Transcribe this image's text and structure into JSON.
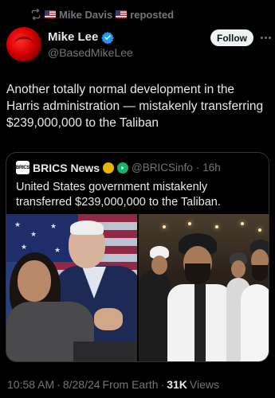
{
  "repost": {
    "icon": "repost-icon",
    "user": "Mike Davis",
    "action": "reposted",
    "flag_icon": "us-flag-icon"
  },
  "author": {
    "display_name": "Mike Lee",
    "handle": "@BasedMikeLee",
    "verified_icon": "verified-badge-icon",
    "avatar_color": "#d60000"
  },
  "actions": {
    "follow_label": "Follow",
    "more_icon": "more-icon"
  },
  "tweet": {
    "text": "Another totally normal development in the Harris administration — mistakenly transferring $239,000,000 to the Taliban"
  },
  "quote": {
    "avatar_text": "BRICS",
    "name": "BRICS News",
    "handle": "@BRICSinfo",
    "separator": "·",
    "time": "16h",
    "text": "United States government mistakenly transferred $239,000,000 to the Taliban.",
    "badges": [
      "gold-badge-icon",
      "green-verified-icon"
    ]
  },
  "meta": {
    "time": "10:58 AM",
    "separator": "·",
    "date": "8/28/24",
    "source": "From Earth",
    "separator2": "·",
    "views_count": "31K",
    "views_label": "Views"
  },
  "colors": {
    "background": "#000000",
    "text": "#e7e9ea",
    "muted": "#71767b",
    "verified_blue": "#1d9bf0",
    "border": "#2f3336"
  }
}
